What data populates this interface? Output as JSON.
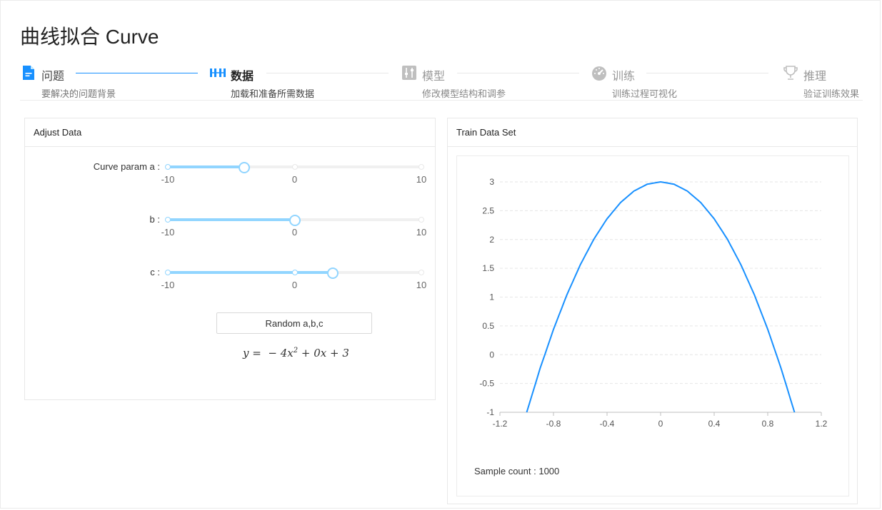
{
  "title": "曲线拟合 Curve",
  "steps": [
    {
      "label": "问题",
      "desc": "要解决的问题背景",
      "icon": "file-icon"
    },
    {
      "label": "数据",
      "desc": "加载和准备所需数据",
      "icon": "columns-icon"
    },
    {
      "label": "模型",
      "desc": "修改模型结构和调参",
      "icon": "sliders-icon"
    },
    {
      "label": "训练",
      "desc": "训练过程可视化",
      "icon": "dashboard-icon"
    },
    {
      "label": "推理",
      "desc": "验证训练效果",
      "icon": "trophy-icon"
    }
  ],
  "adjust": {
    "title": "Adjust Data",
    "sliders": [
      {
        "label": "Curve param a :",
        "min": -10,
        "max": 10,
        "value": -4,
        "marks": [
          "-10",
          "0",
          "10"
        ]
      },
      {
        "label": "b :",
        "min": -10,
        "max": 10,
        "value": 0,
        "marks": [
          "-10",
          "0",
          "10"
        ]
      },
      {
        "label": "c :",
        "min": -10,
        "max": 10,
        "value": 3,
        "marks": [
          "-10",
          "0",
          "10"
        ]
      }
    ],
    "button": "Random a,b,c",
    "formula": {
      "lhs": "y = ",
      "a": "− 4",
      "x2": "x",
      "exp": "2",
      "bx": " + 0x",
      "c": " + 3"
    }
  },
  "train": {
    "title": "Train Data Set",
    "sample_label": "Sample count :",
    "sample_value": "1000",
    "accent": "#1890ff"
  },
  "chart_data": {
    "type": "line",
    "title": "",
    "xlabel": "",
    "ylabel": "",
    "xlim": [
      -1.2,
      1.2
    ],
    "ylim": [
      -1,
      3
    ],
    "x_ticks": [
      "-1.2",
      "-0.8",
      "-0.4",
      "0",
      "0.4",
      "0.8",
      "1.2"
    ],
    "y_ticks": [
      "-1",
      "-0.5",
      "0",
      "0.5",
      "1",
      "1.5",
      "2",
      "2.5",
      "3"
    ],
    "grid": true,
    "legend": "bottom-center",
    "series": [
      {
        "name": "y",
        "color": "#1890ff",
        "x": [
          -1.0,
          -0.9,
          -0.8,
          -0.7,
          -0.6,
          -0.5,
          -0.4,
          -0.3,
          -0.2,
          -0.1,
          0,
          0.1,
          0.2,
          0.3,
          0.4,
          0.5,
          0.6,
          0.7,
          0.8,
          0.9,
          1.0
        ],
        "y": [
          -1.0,
          -0.24,
          0.44,
          1.04,
          1.56,
          2.0,
          2.36,
          2.64,
          2.84,
          2.96,
          3.0,
          2.96,
          2.84,
          2.64,
          2.36,
          2.0,
          1.56,
          1.04,
          0.44,
          -0.24,
          -1.0
        ]
      }
    ]
  }
}
